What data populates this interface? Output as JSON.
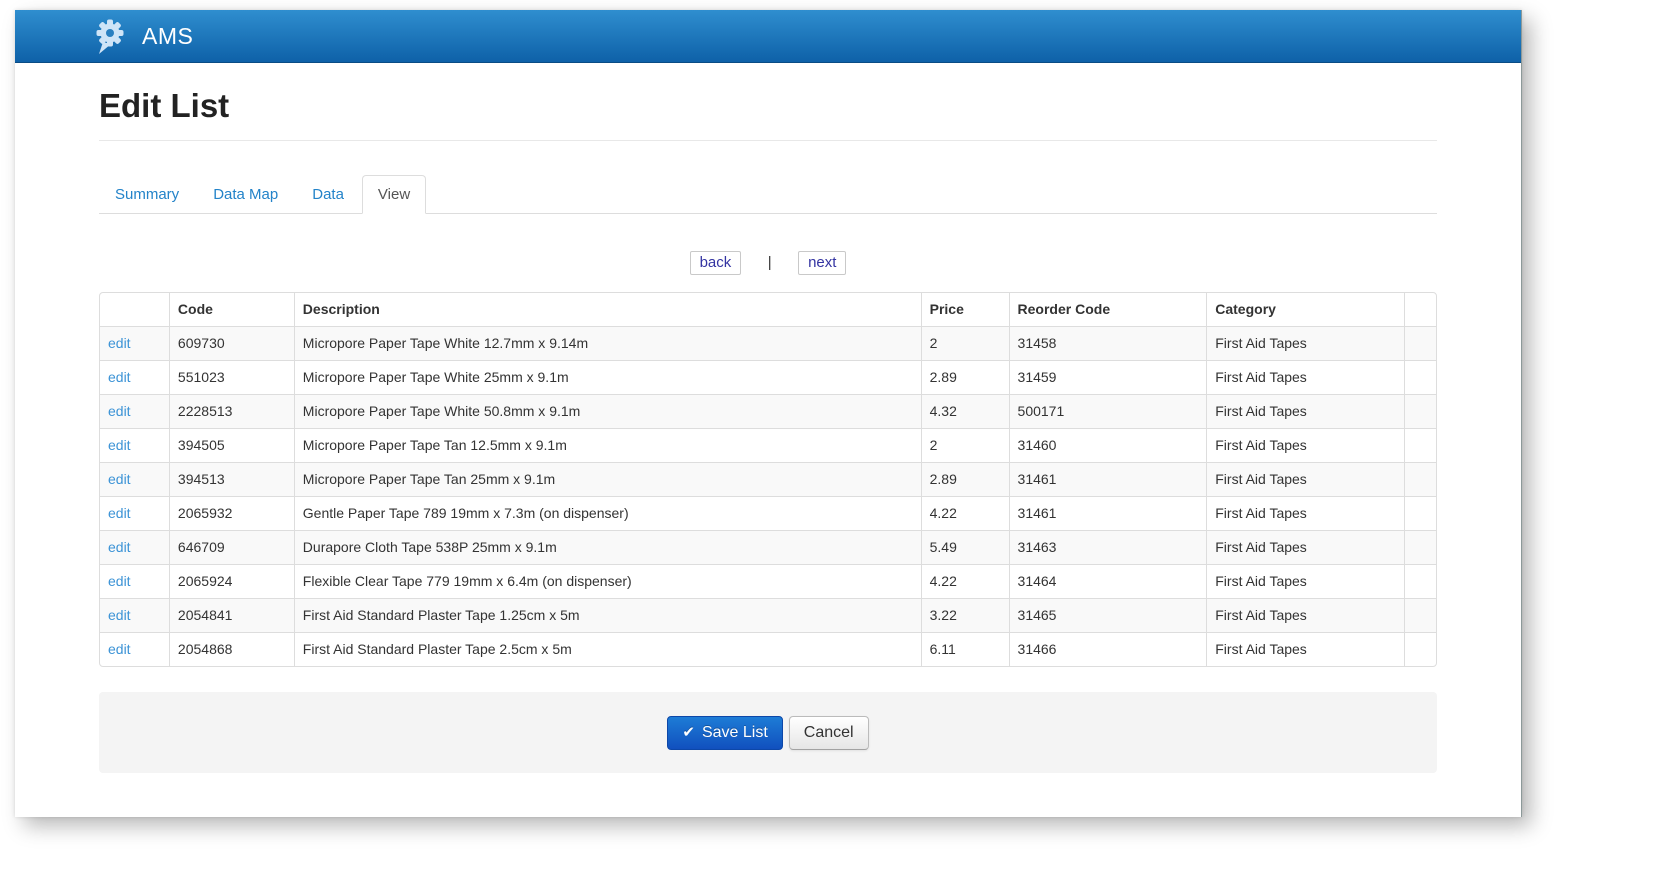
{
  "navbar": {
    "brand": "AMS"
  },
  "page": {
    "title": "Edit List"
  },
  "tabs": [
    {
      "label": "Summary",
      "active": false
    },
    {
      "label": "Data Map",
      "active": false
    },
    {
      "label": "Data",
      "active": false
    },
    {
      "label": "View",
      "active": true
    }
  ],
  "pager": {
    "back_label": "back",
    "separator": "|",
    "next_label": "next"
  },
  "table": {
    "headers": [
      "",
      "Code",
      "Description",
      "Price",
      "Reorder Code",
      "Category",
      ""
    ],
    "edit_label": "edit",
    "rows": [
      {
        "code": "609730",
        "description": "Micropore Paper Tape White 12.7mm x 9.14m",
        "price": "2",
        "reorder_code": "31458",
        "category": "First Aid Tapes"
      },
      {
        "code": "551023",
        "description": "Micropore Paper Tape White 25mm x 9.1m",
        "price": "2.89",
        "reorder_code": "31459",
        "category": "First Aid Tapes"
      },
      {
        "code": "2228513",
        "description": "Micropore Paper Tape White 50.8mm x 9.1m",
        "price": "4.32",
        "reorder_code": "500171",
        "category": "First Aid Tapes"
      },
      {
        "code": "394505",
        "description": "Micropore Paper Tape Tan 12.5mm x 9.1m",
        "price": "2",
        "reorder_code": "31460",
        "category": "First Aid Tapes"
      },
      {
        "code": "394513",
        "description": "Micropore Paper Tape Tan 25mm x 9.1m",
        "price": "2.89",
        "reorder_code": "31461",
        "category": "First Aid Tapes"
      },
      {
        "code": "2065932",
        "description": "Gentle Paper Tape 789 19mm x 7.3m (on dispenser)",
        "price": "4.22",
        "reorder_code": "31461",
        "category": "First Aid Tapes"
      },
      {
        "code": "646709",
        "description": "Durapore Cloth Tape 538P 25mm x 9.1m",
        "price": "5.49",
        "reorder_code": "31463",
        "category": "First Aid Tapes"
      },
      {
        "code": "2065924",
        "description": "Flexible Clear Tape 779 19mm x 6.4m (on dispenser)",
        "price": "4.22",
        "reorder_code": "31464",
        "category": "First Aid Tapes"
      },
      {
        "code": "2054841",
        "description": "First Aid Standard Plaster Tape 1.25cm x 5m",
        "price": "3.22",
        "reorder_code": "31465",
        "category": "First Aid Tapes"
      },
      {
        "code": "2054868",
        "description": "First Aid Standard Plaster Tape 2.5cm x 5m",
        "price": "6.11",
        "reorder_code": "31466",
        "category": "First Aid Tapes"
      }
    ]
  },
  "actions": {
    "save_label": "Save List",
    "save_check_glyph": "✔",
    "cancel_label": "Cancel"
  },
  "colors": {
    "navbar_top": "#2f8ecf",
    "navbar_bottom": "#0e61a8",
    "link_blue": "#2383c9",
    "primary_button": "#1150be",
    "pager_text": "#3434a2"
  }
}
